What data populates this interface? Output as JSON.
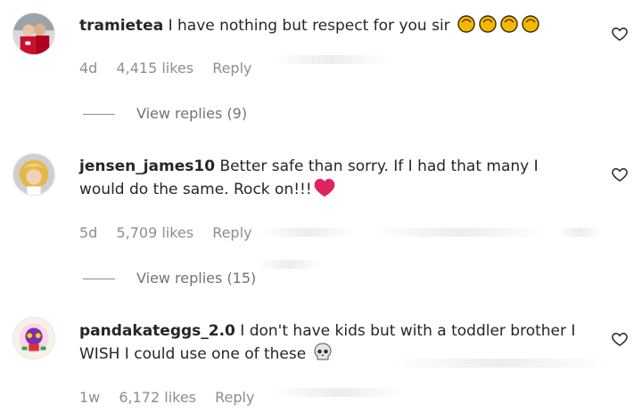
{
  "comments": [
    {
      "username": "tramietea",
      "text": "I have nothing but respect for you sir",
      "emoji": "clapping-hands-emoji x4",
      "age": "4d",
      "likes": "4,415 likes",
      "reply": "Reply",
      "view_replies": "View replies (9)"
    },
    {
      "username": "jensen_james10",
      "text": "Better safe than sorry. If I had that many I would do the same. Rock on!!!",
      "emoji": "red-heart-emoji",
      "age": "5d",
      "likes": "5,709 likes",
      "reply": "Reply",
      "view_replies": "View replies (15)"
    },
    {
      "username": "pandakateggs_2.0",
      "text": "I don't have kids but with a toddler brother I WISH I could use one of these",
      "emoji": "skull-emoji",
      "age": "1w",
      "likes": "6,172 likes",
      "reply": "Reply"
    }
  ],
  "icons": {
    "like": "heart-outline-icon"
  },
  "colors": {
    "text": "#262626",
    "meta": "#8e8e8e",
    "heart": "#e0245e",
    "clap": "#f5b800"
  }
}
